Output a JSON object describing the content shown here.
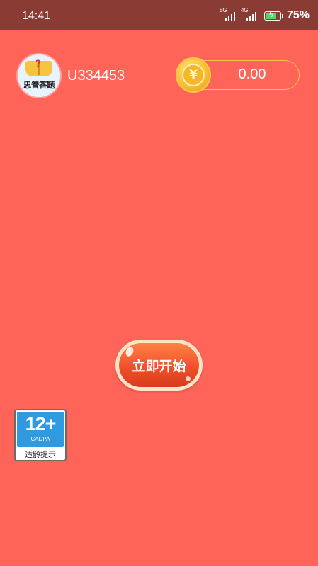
{
  "status_bar": {
    "time": "14:41",
    "network1": "5G",
    "network2": "4G",
    "battery_percent": "75%",
    "battery_level": 0.75
  },
  "header": {
    "app_logo_text": "思普答题",
    "user_id": "U334453",
    "coin_symbol": "¥",
    "balance": "0.00"
  },
  "main": {
    "start_button_label": "立即开始"
  },
  "age_rating": {
    "age": "12+",
    "org": "CADPA",
    "tip": "适龄提示"
  },
  "colors": {
    "background": "#ff6459",
    "status_bar": "#8a3b33",
    "button": "#f0502a",
    "coin": "#fcc436"
  }
}
